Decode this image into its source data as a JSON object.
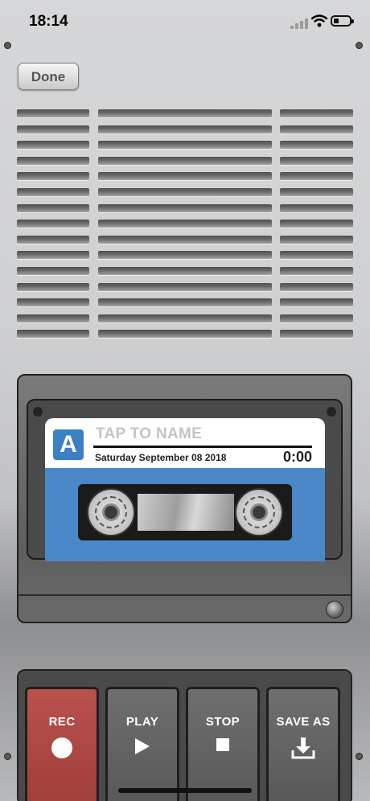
{
  "status_bar": {
    "time": "18:14",
    "battery": "low"
  },
  "toolbar": {
    "done_label": "Done"
  },
  "cassette": {
    "side": "A",
    "name_placeholder": "TAP TO NAME",
    "date": "Saturday September 08 2018",
    "duration": "0:00"
  },
  "controls": {
    "rec_label": "REC",
    "play_label": "PLAY",
    "stop_label": "STOP",
    "save_label": "SAVE AS"
  },
  "colors": {
    "rec": "#b04a46",
    "cassette_blue": "#4a87c9",
    "body": "#d1d2d4"
  },
  "icons": [
    "signal-icon",
    "wifi-icon",
    "battery-icon",
    "record-icon",
    "play-icon",
    "stop-icon",
    "download-icon"
  ]
}
